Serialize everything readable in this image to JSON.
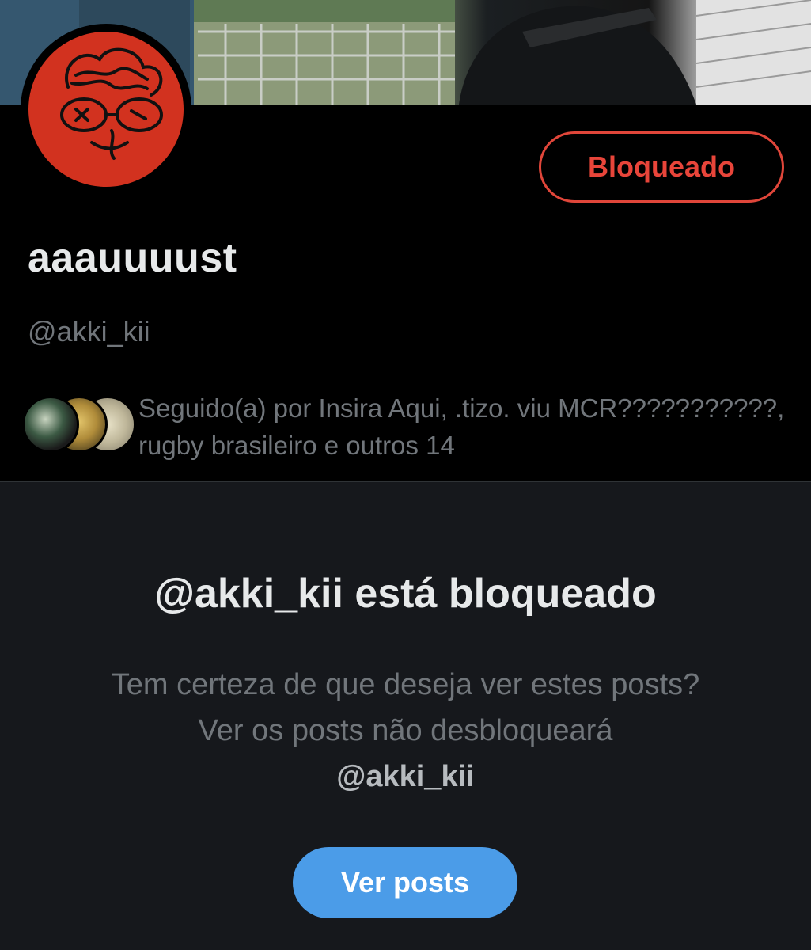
{
  "profile": {
    "display_name": "aaauuuust",
    "handle": "@akki_kii",
    "blocked_button_label": "Bloqueado",
    "followed_by_text": "Seguido(a) por Insira Aqui, .tizo. viu MCR???????????, rugby brasileiro e outros 14"
  },
  "blocked_notice": {
    "title": "@akki_kii está bloqueado",
    "description": "Tem certeza de que deseja ver estes posts? Ver os posts não desbloqueará",
    "description_handle": "@akki_kii",
    "view_posts_label": "Ver posts"
  },
  "colors": {
    "background": "#000000",
    "panel": "#16181c",
    "accent_blue": "#4b9ce8",
    "danger_red": "#e8453a",
    "avatar_red": "#d2321f"
  }
}
